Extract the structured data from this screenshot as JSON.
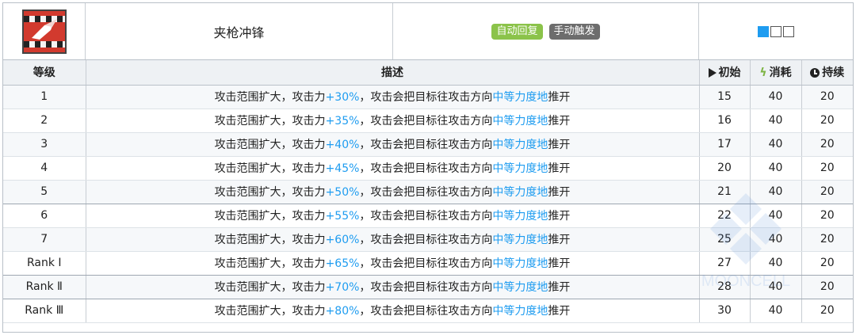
{
  "skill": {
    "name": "夹枪冲锋",
    "tags": [
      "自动回复",
      "手动触发"
    ],
    "sp_boxes": [
      true,
      false,
      false
    ]
  },
  "table": {
    "headers": {
      "level": "等级",
      "desc": "描述",
      "init": "初始",
      "cost": "消耗",
      "duration": "持续"
    },
    "rows": [
      {
        "level": "1",
        "pre": "攻击范围扩大，攻击力",
        "pct": "+30%",
        "mid": "，攻击会把目标往攻击方向",
        "force": "中等力度地",
        "post": "推开",
        "init": "15",
        "cost": "40",
        "duration": "20"
      },
      {
        "level": "2",
        "pre": "攻击范围扩大，攻击力",
        "pct": "+35%",
        "mid": "，攻击会把目标往攻击方向",
        "force": "中等力度地",
        "post": "推开",
        "init": "16",
        "cost": "40",
        "duration": "20"
      },
      {
        "level": "3",
        "pre": "攻击范围扩大，攻击力",
        "pct": "+40%",
        "mid": "，攻击会把目标往攻击方向",
        "force": "中等力度地",
        "post": "推开",
        "init": "17",
        "cost": "40",
        "duration": "20"
      },
      {
        "level": "4",
        "pre": "攻击范围扩大，攻击力",
        "pct": "+45%",
        "mid": "，攻击会把目标往攻击方向",
        "force": "中等力度地",
        "post": "推开",
        "init": "20",
        "cost": "40",
        "duration": "20"
      },
      {
        "level": "5",
        "pre": "攻击范围扩大，攻击力",
        "pct": "+50%",
        "mid": "，攻击会把目标往攻击方向",
        "force": "中等力度地",
        "post": "推开",
        "init": "21",
        "cost": "40",
        "duration": "20"
      },
      {
        "level": "6",
        "pre": "攻击范围扩大，攻击力",
        "pct": "+55%",
        "mid": "，攻击会把目标往攻击方向",
        "force": "中等力度地",
        "post": "推开",
        "init": "22",
        "cost": "40",
        "duration": "20"
      },
      {
        "level": "7",
        "pre": "攻击范围扩大，攻击力",
        "pct": "+60%",
        "mid": "，攻击会把目标往攻击方向",
        "force": "中等力度地",
        "post": "推开",
        "init": "25",
        "cost": "40",
        "duration": "20"
      },
      {
        "level": "Rank Ⅰ",
        "pre": "攻击范围扩大，攻击力",
        "pct": "+65%",
        "mid": "，攻击会把目标往攻击方向",
        "force": "中等力度地",
        "post": "推开",
        "init": "27",
        "cost": "40",
        "duration": "20"
      },
      {
        "level": "Rank Ⅱ",
        "pre": "攻击范围扩大，攻击力",
        "pct": "+70%",
        "mid": "，攻击会把目标往攻击方向",
        "force": "中等力度地",
        "post": "推开",
        "init": "28",
        "cost": "40",
        "duration": "20"
      },
      {
        "level": "Rank Ⅲ",
        "pre": "攻击范围扩大，攻击力",
        "pct": "+80%",
        "mid": "，攻击会把目标往攻击方向",
        "force": "中等力度地",
        "post": "推开",
        "init": "30",
        "cost": "40",
        "duration": "20"
      }
    ]
  },
  "watermark": "MOONCELL",
  "colors": {
    "highlight": "#1e9cf0",
    "auto_tag": "#8bc34a",
    "manual_tag": "#6d6d6d",
    "sp_filled": "#1e9cf0"
  },
  "icons": {
    "skill": "lance-charge-skill-icon",
    "init": "play-triangle-icon",
    "cost": "lightning-bolt-icon",
    "duration": "clock-icon"
  }
}
